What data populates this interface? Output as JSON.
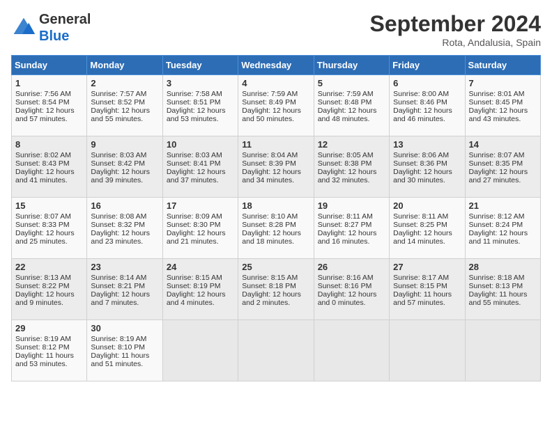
{
  "header": {
    "logo_general": "General",
    "logo_blue": "Blue",
    "month": "September 2024",
    "location": "Rota, Andalusia, Spain"
  },
  "weekdays": [
    "Sunday",
    "Monday",
    "Tuesday",
    "Wednesday",
    "Thursday",
    "Friday",
    "Saturday"
  ],
  "weeks": [
    [
      {
        "day": "1",
        "lines": [
          "Sunrise: 7:56 AM",
          "Sunset: 8:54 PM",
          "Daylight: 12 hours",
          "and 57 minutes."
        ]
      },
      {
        "day": "2",
        "lines": [
          "Sunrise: 7:57 AM",
          "Sunset: 8:52 PM",
          "Daylight: 12 hours",
          "and 55 minutes."
        ]
      },
      {
        "day": "3",
        "lines": [
          "Sunrise: 7:58 AM",
          "Sunset: 8:51 PM",
          "Daylight: 12 hours",
          "and 53 minutes."
        ]
      },
      {
        "day": "4",
        "lines": [
          "Sunrise: 7:59 AM",
          "Sunset: 8:49 PM",
          "Daylight: 12 hours",
          "and 50 minutes."
        ]
      },
      {
        "day": "5",
        "lines": [
          "Sunrise: 7:59 AM",
          "Sunset: 8:48 PM",
          "Daylight: 12 hours",
          "and 48 minutes."
        ]
      },
      {
        "day": "6",
        "lines": [
          "Sunrise: 8:00 AM",
          "Sunset: 8:46 PM",
          "Daylight: 12 hours",
          "and 46 minutes."
        ]
      },
      {
        "day": "7",
        "lines": [
          "Sunrise: 8:01 AM",
          "Sunset: 8:45 PM",
          "Daylight: 12 hours",
          "and 43 minutes."
        ]
      }
    ],
    [
      {
        "day": "8",
        "lines": [
          "Sunrise: 8:02 AM",
          "Sunset: 8:43 PM",
          "Daylight: 12 hours",
          "and 41 minutes."
        ]
      },
      {
        "day": "9",
        "lines": [
          "Sunrise: 8:03 AM",
          "Sunset: 8:42 PM",
          "Daylight: 12 hours",
          "and 39 minutes."
        ]
      },
      {
        "day": "10",
        "lines": [
          "Sunrise: 8:03 AM",
          "Sunset: 8:41 PM",
          "Daylight: 12 hours",
          "and 37 minutes."
        ]
      },
      {
        "day": "11",
        "lines": [
          "Sunrise: 8:04 AM",
          "Sunset: 8:39 PM",
          "Daylight: 12 hours",
          "and 34 minutes."
        ]
      },
      {
        "day": "12",
        "lines": [
          "Sunrise: 8:05 AM",
          "Sunset: 8:38 PM",
          "Daylight: 12 hours",
          "and 32 minutes."
        ]
      },
      {
        "day": "13",
        "lines": [
          "Sunrise: 8:06 AM",
          "Sunset: 8:36 PM",
          "Daylight: 12 hours",
          "and 30 minutes."
        ]
      },
      {
        "day": "14",
        "lines": [
          "Sunrise: 8:07 AM",
          "Sunset: 8:35 PM",
          "Daylight: 12 hours",
          "and 27 minutes."
        ]
      }
    ],
    [
      {
        "day": "15",
        "lines": [
          "Sunrise: 8:07 AM",
          "Sunset: 8:33 PM",
          "Daylight: 12 hours",
          "and 25 minutes."
        ]
      },
      {
        "day": "16",
        "lines": [
          "Sunrise: 8:08 AM",
          "Sunset: 8:32 PM",
          "Daylight: 12 hours",
          "and 23 minutes."
        ]
      },
      {
        "day": "17",
        "lines": [
          "Sunrise: 8:09 AM",
          "Sunset: 8:30 PM",
          "Daylight: 12 hours",
          "and 21 minutes."
        ]
      },
      {
        "day": "18",
        "lines": [
          "Sunrise: 8:10 AM",
          "Sunset: 8:28 PM",
          "Daylight: 12 hours",
          "and 18 minutes."
        ]
      },
      {
        "day": "19",
        "lines": [
          "Sunrise: 8:11 AM",
          "Sunset: 8:27 PM",
          "Daylight: 12 hours",
          "and 16 minutes."
        ]
      },
      {
        "day": "20",
        "lines": [
          "Sunrise: 8:11 AM",
          "Sunset: 8:25 PM",
          "Daylight: 12 hours",
          "and 14 minutes."
        ]
      },
      {
        "day": "21",
        "lines": [
          "Sunrise: 8:12 AM",
          "Sunset: 8:24 PM",
          "Daylight: 12 hours",
          "and 11 minutes."
        ]
      }
    ],
    [
      {
        "day": "22",
        "lines": [
          "Sunrise: 8:13 AM",
          "Sunset: 8:22 PM",
          "Daylight: 12 hours",
          "and 9 minutes."
        ]
      },
      {
        "day": "23",
        "lines": [
          "Sunrise: 8:14 AM",
          "Sunset: 8:21 PM",
          "Daylight: 12 hours",
          "and 7 minutes."
        ]
      },
      {
        "day": "24",
        "lines": [
          "Sunrise: 8:15 AM",
          "Sunset: 8:19 PM",
          "Daylight: 12 hours",
          "and 4 minutes."
        ]
      },
      {
        "day": "25",
        "lines": [
          "Sunrise: 8:15 AM",
          "Sunset: 8:18 PM",
          "Daylight: 12 hours",
          "and 2 minutes."
        ]
      },
      {
        "day": "26",
        "lines": [
          "Sunrise: 8:16 AM",
          "Sunset: 8:16 PM",
          "Daylight: 12 hours",
          "and 0 minutes."
        ]
      },
      {
        "day": "27",
        "lines": [
          "Sunrise: 8:17 AM",
          "Sunset: 8:15 PM",
          "Daylight: 11 hours",
          "and 57 minutes."
        ]
      },
      {
        "day": "28",
        "lines": [
          "Sunrise: 8:18 AM",
          "Sunset: 8:13 PM",
          "Daylight: 11 hours",
          "and 55 minutes."
        ]
      }
    ],
    [
      {
        "day": "29",
        "lines": [
          "Sunrise: 8:19 AM",
          "Sunset: 8:12 PM",
          "Daylight: 11 hours",
          "and 53 minutes."
        ]
      },
      {
        "day": "30",
        "lines": [
          "Sunrise: 8:19 AM",
          "Sunset: 8:10 PM",
          "Daylight: 11 hours",
          "and 51 minutes."
        ]
      },
      null,
      null,
      null,
      null,
      null
    ]
  ]
}
